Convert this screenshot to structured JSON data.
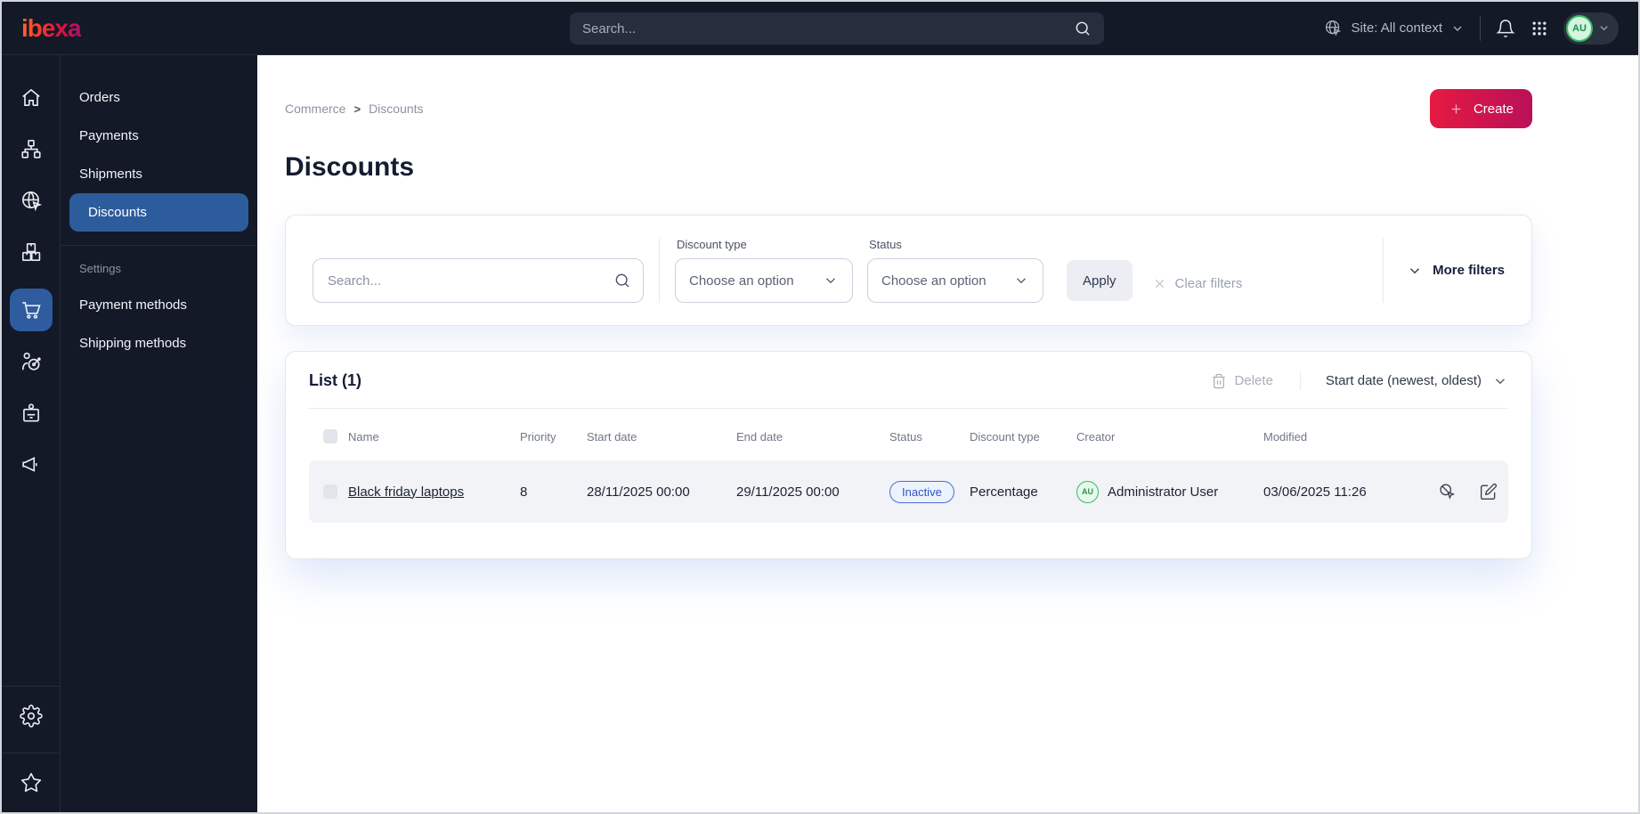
{
  "topbar": {
    "logo": "ibexa",
    "search_placeholder": "Search...",
    "site_context": "Site: All context",
    "avatar_initials": "AU"
  },
  "sidebar": {
    "rail_icons": [
      "home",
      "content-tree",
      "site",
      "product-catalog",
      "commerce",
      "personalization",
      "customer-portal",
      "marketing",
      "settings",
      "bookmarks"
    ],
    "menu": {
      "items": [
        {
          "label": "Orders"
        },
        {
          "label": "Payments"
        },
        {
          "label": "Shipments"
        },
        {
          "label": "Discounts"
        }
      ],
      "settings_label": "Settings",
      "settings_items": [
        {
          "label": "Payment methods"
        },
        {
          "label": "Shipping methods"
        }
      ]
    }
  },
  "main": {
    "breadcrumb": {
      "items": [
        "Commerce",
        "Discounts"
      ],
      "separator": ">"
    },
    "create_label": "Create",
    "page_title": "Discounts",
    "filters": {
      "search_placeholder": "Search...",
      "discount_type_label": "Discount type",
      "discount_type_value": "Choose an option",
      "status_label": "Status",
      "status_value": "Choose an option",
      "apply_label": "Apply",
      "clear_label": "Clear filters",
      "more_label": "More filters"
    },
    "list": {
      "title": "List (1)",
      "delete_label": "Delete",
      "sort_label": "Start date (newest, oldest)",
      "columns": [
        "Name",
        "Priority",
        "Start date",
        "End date",
        "Status",
        "Discount type",
        "Creator",
        "Modified"
      ],
      "rows": [
        {
          "name": "Black friday laptops",
          "priority": "8",
          "start_date": "28/11/2025 00:00",
          "end_date": "29/11/2025 00:00",
          "status": "Inactive",
          "discount_type": "Percentage",
          "creator": "Administrator User",
          "creator_initials": "AU",
          "modified": "03/06/2025 11:26"
        }
      ]
    }
  },
  "colors": {
    "topbar_bg": "#131927",
    "active_nav_blue": "#2d5c9c",
    "create_gradient_start": "#e51a42",
    "create_gradient_end": "#ba1059",
    "badge_blue_text": "#2f55cb",
    "badge_blue_border": "#4a6fd4",
    "avatar_green": "#36bd5f"
  }
}
